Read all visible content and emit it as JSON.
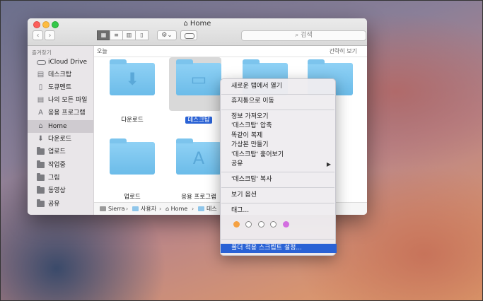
{
  "window": {
    "title": "Home",
    "search_placeholder": "검색",
    "view_modes": [
      "icon-view",
      "list-view",
      "column-view",
      "cover-flow-view"
    ],
    "active_view": "icon-view"
  },
  "sidebar": {
    "header": "즐겨찾기",
    "items": [
      {
        "label": "iCloud Drive",
        "icon": "cloud-icon"
      },
      {
        "label": "데스크탑",
        "icon": "desktop-icon"
      },
      {
        "label": "도큐멘트",
        "icon": "documents-icon"
      },
      {
        "label": "나의 모든 파일",
        "icon": "all-files-icon"
      },
      {
        "label": "응용 프로그램",
        "icon": "applications-icon"
      },
      {
        "label": "Home",
        "icon": "home-icon",
        "selected": true
      },
      {
        "label": "다운로드",
        "icon": "downloads-icon"
      },
      {
        "label": "업로드",
        "icon": "folder-icon"
      },
      {
        "label": "작업중",
        "icon": "folder-icon"
      },
      {
        "label": "그림",
        "icon": "folder-icon"
      },
      {
        "label": "동영상",
        "icon": "folder-icon"
      },
      {
        "label": "공유",
        "icon": "folder-icon"
      }
    ]
  },
  "content": {
    "section_label": "오늘",
    "brief_label": "간략히 보기",
    "items": [
      {
        "label": "다운로드",
        "glyph": "download-arrow-icon"
      },
      {
        "label": "데스크탑",
        "glyph": "desktop-window-icon",
        "selected": true
      },
      {
        "label": "",
        "glyph": ""
      },
      {
        "label": "",
        "glyph": ""
      },
      {
        "label": "업로드",
        "glyph": ""
      },
      {
        "label": "응용 프로그램",
        "glyph": "app-store-icon"
      }
    ]
  },
  "pathbar": {
    "segments": [
      "Sierra",
      "사용자",
      "Home",
      "데스"
    ]
  },
  "context_menu": {
    "items": [
      "새로운 탭에서 열기",
      "휴지통으로 이동",
      "정보 가져오기",
      "'데스크탑' 압축",
      "똑같이 복제",
      "가상본 만들기",
      "'데스크탑' 훑어보기",
      "공유",
      "'데스크탑' 복사",
      "보기 옵션",
      "태그...",
      "폴더 적용 스크립트 설정..."
    ],
    "highlighted": "폴더 적용 스크립트 설정...",
    "tag_colors": [
      "#f5a142",
      "#ffffff",
      "#ffffff",
      "#ffffff",
      "#d36ee0"
    ]
  }
}
